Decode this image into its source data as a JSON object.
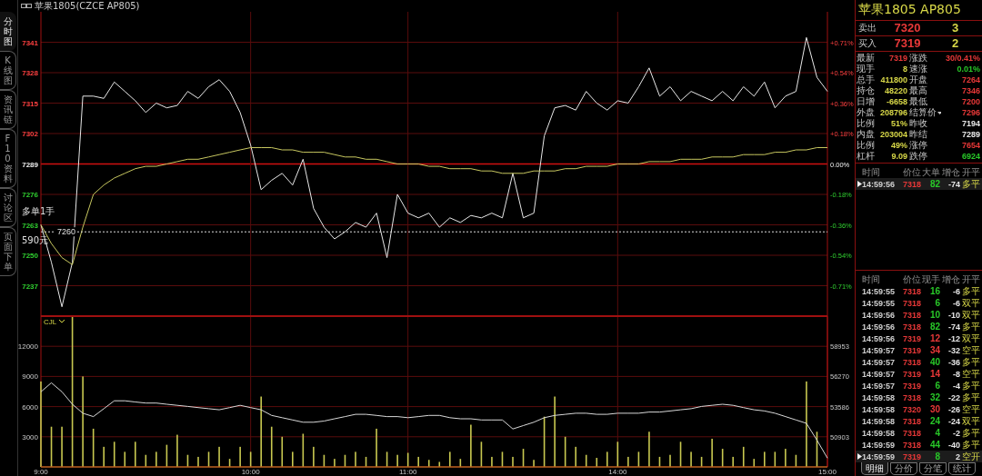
{
  "side_tabs": [
    {
      "label": "分时图",
      "selected": true
    },
    {
      "label": "K线图",
      "selected": false
    },
    {
      "label": "资讯链",
      "selected": false
    },
    {
      "label": "F10资料",
      "selected": false
    },
    {
      "label": "讨论区",
      "selected": false
    },
    {
      "label": "页面下单",
      "selected": false
    }
  ],
  "title": {
    "text": "苹果1805(CZCE AP805)"
  },
  "price_chart": {
    "percent_labels": [
      "+0.71%",
      "+0.54%",
      "+0.36%",
      "+0.18%",
      "0.00%",
      "-0.18%",
      "-0.36%",
      "-0.54%",
      "-0.71%"
    ],
    "position": {
      "side": "多单1手",
      "pnl": "590元"
    },
    "chart_data": {
      "type": "line",
      "ylim": [
        7224,
        7354
      ],
      "yticks": [
        7237,
        7250,
        7263,
        7276,
        7289,
        7302,
        7315,
        7328,
        7341
      ],
      "grid": true,
      "ref_lines": [
        {
          "axis": "y",
          "value": 7289,
          "color": "#d01010"
        },
        {
          "axis": "y",
          "value": 7260,
          "label": "7260",
          "color": "#dddddd"
        }
      ],
      "categories": [
        null,
        null,
        null,
        null,
        null,
        null,
        null,
        null,
        null,
        null,
        null,
        null,
        null,
        null,
        null,
        null,
        null,
        null,
        null,
        null,
        null,
        null,
        null,
        null,
        null,
        null,
        null,
        null,
        null,
        null,
        null,
        null,
        null,
        null,
        null,
        null,
        null,
        null,
        null,
        null,
        null,
        null,
        null,
        null,
        null,
        null,
        null,
        null,
        null,
        null,
        null,
        null,
        null,
        null,
        null,
        null,
        null,
        null,
        null,
        null,
        null,
        null,
        null,
        null,
        null,
        null,
        null,
        null,
        null,
        null,
        null,
        null,
        null,
        null,
        null,
        null
      ],
      "series": [
        {
          "color": "#e8e8e8",
          "values": [
            7263,
            7247,
            7228,
            7247,
            7318,
            7318,
            7317,
            7324,
            7320,
            7316,
            7311,
            7315,
            7313,
            7314,
            7320,
            7317,
            7322,
            7325,
            7320,
            7311,
            7297,
            7278,
            7282,
            7285,
            7280,
            7291,
            7270,
            7262,
            7257,
            7260,
            7264,
            7262,
            7268,
            7249,
            7276,
            7268,
            7266,
            7268,
            7262,
            7266,
            7264,
            7267,
            7266,
            7268,
            7266,
            7285,
            7266,
            7268,
            7301,
            7313,
            7314,
            7312,
            7320,
            7315,
            7312,
            7316,
            7315,
            7322,
            7330,
            7318,
            7322,
            7316,
            7320,
            7318,
            7316,
            7320,
            7316,
            7322,
            7318,
            7324,
            7313,
            7318,
            7320,
            7343,
            7326,
            7320
          ]
        },
        {
          "color": "#c8c860",
          "values": [
            7263,
            7255,
            7249,
            7246,
            7262,
            7276,
            7280,
            7283,
            7285,
            7287,
            7288,
            7288,
            7289,
            7290,
            7291,
            7291,
            7292,
            7293,
            7294,
            7295,
            7296,
            7296,
            7296,
            7295,
            7295,
            7294,
            7294,
            7294,
            7293,
            7292,
            7292,
            7291,
            7291,
            7290,
            7289,
            7289,
            7289,
            7288,
            7288,
            7287,
            7287,
            7287,
            7286,
            7286,
            7285,
            7285,
            7285,
            7286,
            7286,
            7286,
            7287,
            7287,
            7288,
            7288,
            7288,
            7289,
            7289,
            7289,
            7290,
            7290,
            7290,
            7291,
            7291,
            7291,
            7292,
            7292,
            7292,
            7293,
            7293,
            7293,
            7294,
            7294,
            7295,
            7295,
            7296,
            7296
          ]
        }
      ]
    }
  },
  "volume_chart": {
    "indicator": "CJL",
    "chart_data": {
      "type": "bar",
      "grid": true,
      "ylim": [
        0,
        15000
      ],
      "yticks": [
        3000,
        6000,
        9000,
        12000
      ],
      "categories": [
        "9:00",
        null,
        null,
        null,
        null,
        null,
        null,
        null,
        null,
        null,
        null,
        null,
        null,
        null,
        null,
        null,
        null,
        null,
        null,
        null,
        "10:00",
        null,
        null,
        null,
        null,
        null,
        null,
        null,
        null,
        null,
        null,
        null,
        null,
        null,
        null,
        "11:00",
        null,
        null,
        null,
        null,
        null,
        null,
        null,
        null,
        null,
        null,
        null,
        null,
        null,
        null,
        null,
        null,
        null,
        null,
        null,
        "14:00",
        null,
        null,
        null,
        null,
        null,
        null,
        null,
        null,
        null,
        null,
        null,
        null,
        null,
        null,
        null,
        null,
        null,
        null,
        null,
        "15:00"
      ],
      "series": [
        {
          "color": "#c8c850",
          "values": [
            8500,
            4000,
            4000,
            15000,
            9000,
            3800,
            2000,
            2500,
            1500,
            2500,
            1200,
            1500,
            2200,
            3200,
            1200,
            1000,
            1500,
            2000,
            800,
            2000,
            1500,
            7000,
            4000,
            3000,
            1500,
            3300,
            2000,
            1200,
            800,
            1200,
            1500,
            1000,
            3800,
            1500,
            1200,
            1400,
            1000,
            700,
            500,
            1500,
            800,
            4200,
            2500,
            1000,
            1500,
            1000,
            1800,
            700,
            5000,
            7000,
            3000,
            2000,
            1200,
            900,
            1500,
            2500,
            1000,
            1500,
            3500,
            1000,
            1200,
            2500,
            1500,
            1000,
            2800,
            1800,
            1000,
            2000,
            800,
            1500,
            1500,
            1800,
            1200,
            8500,
            3500,
            null
          ]
        }
      ]
    }
  },
  "open_interest_chart": {
    "chart_data": {
      "type": "line",
      "ylim": [
        48220,
        61636
      ],
      "yticks": [
        50903,
        53586,
        56270,
        58953
      ],
      "categories": [
        null,
        null,
        null,
        null,
        null,
        null,
        null,
        null,
        null,
        null,
        null,
        null,
        null,
        null,
        null,
        null,
        null,
        null,
        null,
        null,
        null,
        null,
        null,
        null,
        null,
        null,
        null,
        null,
        null,
        null,
        null,
        null,
        null,
        null,
        null,
        null,
        null,
        null,
        null,
        null,
        null,
        null,
        null,
        null,
        null,
        null,
        null,
        null,
        null,
        null,
        null,
        null,
        null,
        null,
        null,
        null,
        null,
        null,
        null,
        null,
        null,
        null,
        null,
        null,
        null,
        null,
        null,
        null,
        null,
        null,
        null,
        null,
        null,
        null,
        null,
        null
      ],
      "series": [
        {
          "color": "#d8d8d8",
          "values": [
            54900,
            55700,
            54900,
            53800,
            53000,
            52700,
            53400,
            54100,
            54100,
            54000,
            53900,
            53900,
            53800,
            53700,
            53600,
            53500,
            53400,
            53300,
            53500,
            53700,
            53500,
            53300,
            52800,
            52600,
            52400,
            52200,
            52200,
            52300,
            52500,
            52700,
            52900,
            52900,
            52800,
            52700,
            52700,
            52600,
            52700,
            52800,
            52800,
            52600,
            52500,
            52500,
            52400,
            52400,
            52400,
            51600,
            51900,
            52200,
            52600,
            52800,
            52900,
            53000,
            53000,
            52900,
            52900,
            53000,
            53000,
            53000,
            53100,
            53100,
            53200,
            53300,
            53400,
            53600,
            53700,
            53800,
            53700,
            53500,
            53300,
            53200,
            53000,
            52700,
            52400,
            52100,
            50600,
            49000
          ]
        }
      ]
    }
  },
  "quote": {
    "title": "苹果1805 AP805",
    "ask": {
      "label": "卖出",
      "price": "7320",
      "size": "3"
    },
    "bid": {
      "label": "买入",
      "price": "7319",
      "size": "2"
    }
  },
  "stats": [
    {
      "left": {
        "label": "最新",
        "value": "7319",
        "color": "#e83838"
      },
      "right": {
        "label": "涨跌",
        "value": "30/0.41%",
        "color": "#e83838"
      }
    },
    {
      "left": {
        "label": "现手",
        "value": "8",
        "color": "#d8d848"
      },
      "right": {
        "label": "速涨",
        "value": "0.01%",
        "color": "#28c828"
      }
    },
    {
      "left": {
        "label": "总手",
        "value": "411800",
        "color": "#d8d848"
      },
      "right": {
        "label": "开盘",
        "value": "7264",
        "color": "#e83838"
      }
    },
    {
      "left": {
        "label": "持仓",
        "value": "48220",
        "color": "#d8d848"
      },
      "right": {
        "label": "最高",
        "value": "7346",
        "color": "#e83838"
      }
    },
    {
      "left": {
        "label": "日增",
        "value": "-6658",
        "color": "#d8d848"
      },
      "right": {
        "label": "最低",
        "value": "7200",
        "color": "#e83838"
      }
    },
    {
      "left": {
        "label": "外盘",
        "value": "208796",
        "color": "#d8d848"
      },
      "right": {
        "label": "结算价",
        "value": "7296",
        "color": "#e83838",
        "dropdown": true
      }
    },
    {
      "left": {
        "label": "比例",
        "value": "51%",
        "color": "#d8d848"
      },
      "right": {
        "label": "昨收",
        "value": "7194",
        "color": "#e8e8e8"
      }
    },
    {
      "left": {
        "label": "内盘",
        "value": "203004",
        "color": "#d8d848"
      },
      "right": {
        "label": "昨结",
        "value": "7289",
        "color": "#e8e8e8"
      }
    },
    {
      "left": {
        "label": "比例",
        "value": "49%",
        "color": "#d8d848"
      },
      "right": {
        "label": "涨停",
        "value": "7654",
        "color": "#e83838"
      }
    },
    {
      "left": {
        "label": "杠杆",
        "value": "9.09",
        "color": "#d8d848"
      },
      "right": {
        "label": "跌停",
        "value": "6924",
        "color": "#28c828"
      }
    }
  ],
  "big_trades": {
    "columns": [
      "时间",
      "价位",
      "大单",
      "增仓",
      "开平"
    ],
    "rows": [
      {
        "time": "14:59:56",
        "price": "7318",
        "volume": {
          "text": "82",
          "color": "#28c828"
        },
        "change": "-74",
        "type": "多平",
        "selected": true
      }
    ]
  },
  "trades": {
    "columns": [
      "时间",
      "价位",
      "现手",
      "增仓",
      "开平"
    ],
    "rows": [
      {
        "time": "14:59:55",
        "price": "7318",
        "volume": {
          "text": "16",
          "color": "#28c828"
        },
        "change": "-6",
        "type": "多平",
        "selected": false
      },
      {
        "time": "14:59:55",
        "price": "7318",
        "volume": {
          "text": "6",
          "color": "#28c828"
        },
        "change": "-6",
        "type": "双平",
        "selected": false
      },
      {
        "time": "14:59:56",
        "price": "7318",
        "volume": {
          "text": "10",
          "color": "#28c828"
        },
        "change": "-10",
        "type": "双平",
        "selected": false
      },
      {
        "time": "14:59:56",
        "price": "7318",
        "volume": {
          "text": "82",
          "color": "#28c828"
        },
        "change": "-74",
        "type": "多平",
        "selected": false
      },
      {
        "time": "14:59:56",
        "price": "7319",
        "volume": {
          "text": "12",
          "color": "#e83838"
        },
        "change": "-12",
        "type": "双平",
        "selected": false
      },
      {
        "time": "14:59:57",
        "price": "7319",
        "volume": {
          "text": "34",
          "color": "#e83838"
        },
        "change": "-32",
        "type": "空平",
        "selected": false
      },
      {
        "time": "14:59:57",
        "price": "7318",
        "volume": {
          "text": "40",
          "color": "#28c828"
        },
        "change": "-36",
        "type": "多平",
        "selected": false
      },
      {
        "time": "14:59:57",
        "price": "7319",
        "volume": {
          "text": "14",
          "color": "#e83838"
        },
        "change": "-8",
        "type": "空平",
        "selected": false
      },
      {
        "time": "14:59:57",
        "price": "7319",
        "volume": {
          "text": "6",
          "color": "#28c828"
        },
        "change": "-4",
        "type": "多平",
        "selected": false
      },
      {
        "time": "14:59:58",
        "price": "7318",
        "volume": {
          "text": "32",
          "color": "#28c828"
        },
        "change": "-22",
        "type": "多平",
        "selected": false
      },
      {
        "time": "14:59:58",
        "price": "7320",
        "volume": {
          "text": "30",
          "color": "#e83838"
        },
        "change": "-26",
        "type": "空平",
        "selected": false
      },
      {
        "time": "14:59:58",
        "price": "7318",
        "volume": {
          "text": "24",
          "color": "#28c828"
        },
        "change": "-24",
        "type": "双平",
        "selected": false
      },
      {
        "time": "14:59:58",
        "price": "7318",
        "volume": {
          "text": "4",
          "color": "#28c828"
        },
        "change": "-2",
        "type": "多平",
        "selected": false
      },
      {
        "time": "14:59:59",
        "price": "7318",
        "volume": {
          "text": "44",
          "color": "#28c828"
        },
        "change": "-40",
        "type": "多平",
        "selected": false
      },
      {
        "time": "14:59:59",
        "price": "7319",
        "volume": {
          "text": "8",
          "color": "#28c828"
        },
        "change": "2",
        "type": "空开",
        "selected": true
      }
    ]
  },
  "bottom_tabs": [
    {
      "label": "明细",
      "selected": true
    },
    {
      "label": "分价",
      "selected": false
    },
    {
      "label": "分笔",
      "selected": false
    },
    {
      "label": "统计",
      "selected": false
    }
  ]
}
